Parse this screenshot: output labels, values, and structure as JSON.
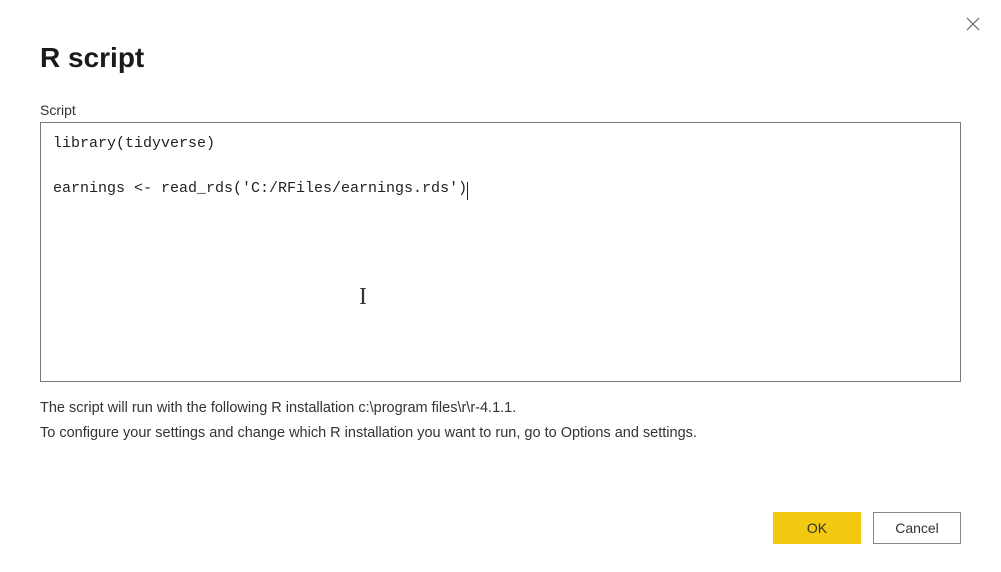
{
  "dialog": {
    "title": "R script",
    "close_icon": "close"
  },
  "field": {
    "label": "Script",
    "value": "library(tidyverse)\n\nearnings <- read_rds('C:/RFiles/earnings.rds')"
  },
  "info": {
    "line1": "The script will run with the following R installation c:\\program files\\r\\r-4.1.1.",
    "line2": "To configure your settings and change which R installation you want to run, go to Options and settings."
  },
  "buttons": {
    "ok": "OK",
    "cancel": "Cancel"
  }
}
